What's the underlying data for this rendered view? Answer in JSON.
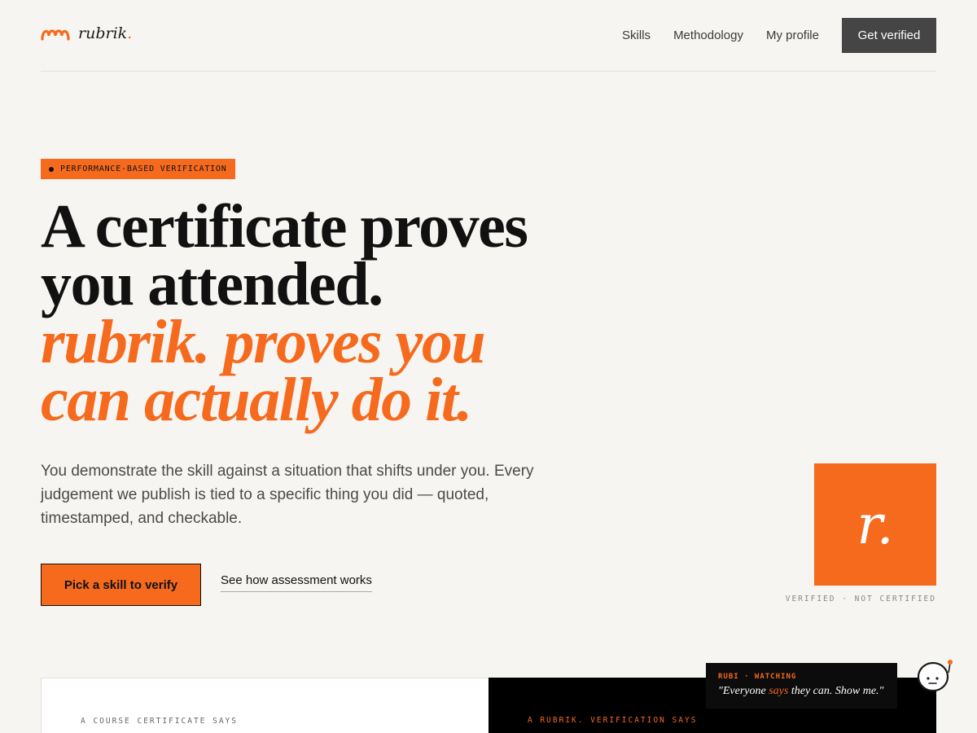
{
  "header": {
    "brand": "rubrik",
    "brand_dot": ".",
    "nav": [
      "Skills",
      "Methodology",
      "My profile"
    ],
    "cta": "Get verified"
  },
  "hero": {
    "badge": "PERFORMANCE-BASED VERIFICATION",
    "headline_lines": [
      "A certificate proves",
      "you attended."
    ],
    "accent_lines": [
      "rubrik. proves you",
      "can actually do it."
    ],
    "lede": "You demonstrate the skill against a situation that shifts under you. Every judgement we publish is tied to a specific thing you did — quoted, timestamped, and checkable.",
    "primary_button": "Pick a skill to verify",
    "secondary_link": "See how assessment works"
  },
  "seal": {
    "letter": "r.",
    "caption": "VERIFIED · NOT CERTIFIED"
  },
  "comparison": {
    "left_label": "A COURSE CERTIFICATE SAYS",
    "right_label": "A RUBRIK. VERIFICATION SAYS"
  },
  "rubi": {
    "label": "RUBI · WATCHING",
    "quote_before": "\"Everyone ",
    "quote_highlight": "says",
    "quote_after": " they can. Show me.\""
  },
  "colors": {
    "accent": "#f66a1e",
    "background": "#f6f5f2",
    "dark": "#454545"
  },
  "icons": {
    "logo": "rubrik-logo-icon",
    "avatar": "rubi-avatar-icon"
  }
}
